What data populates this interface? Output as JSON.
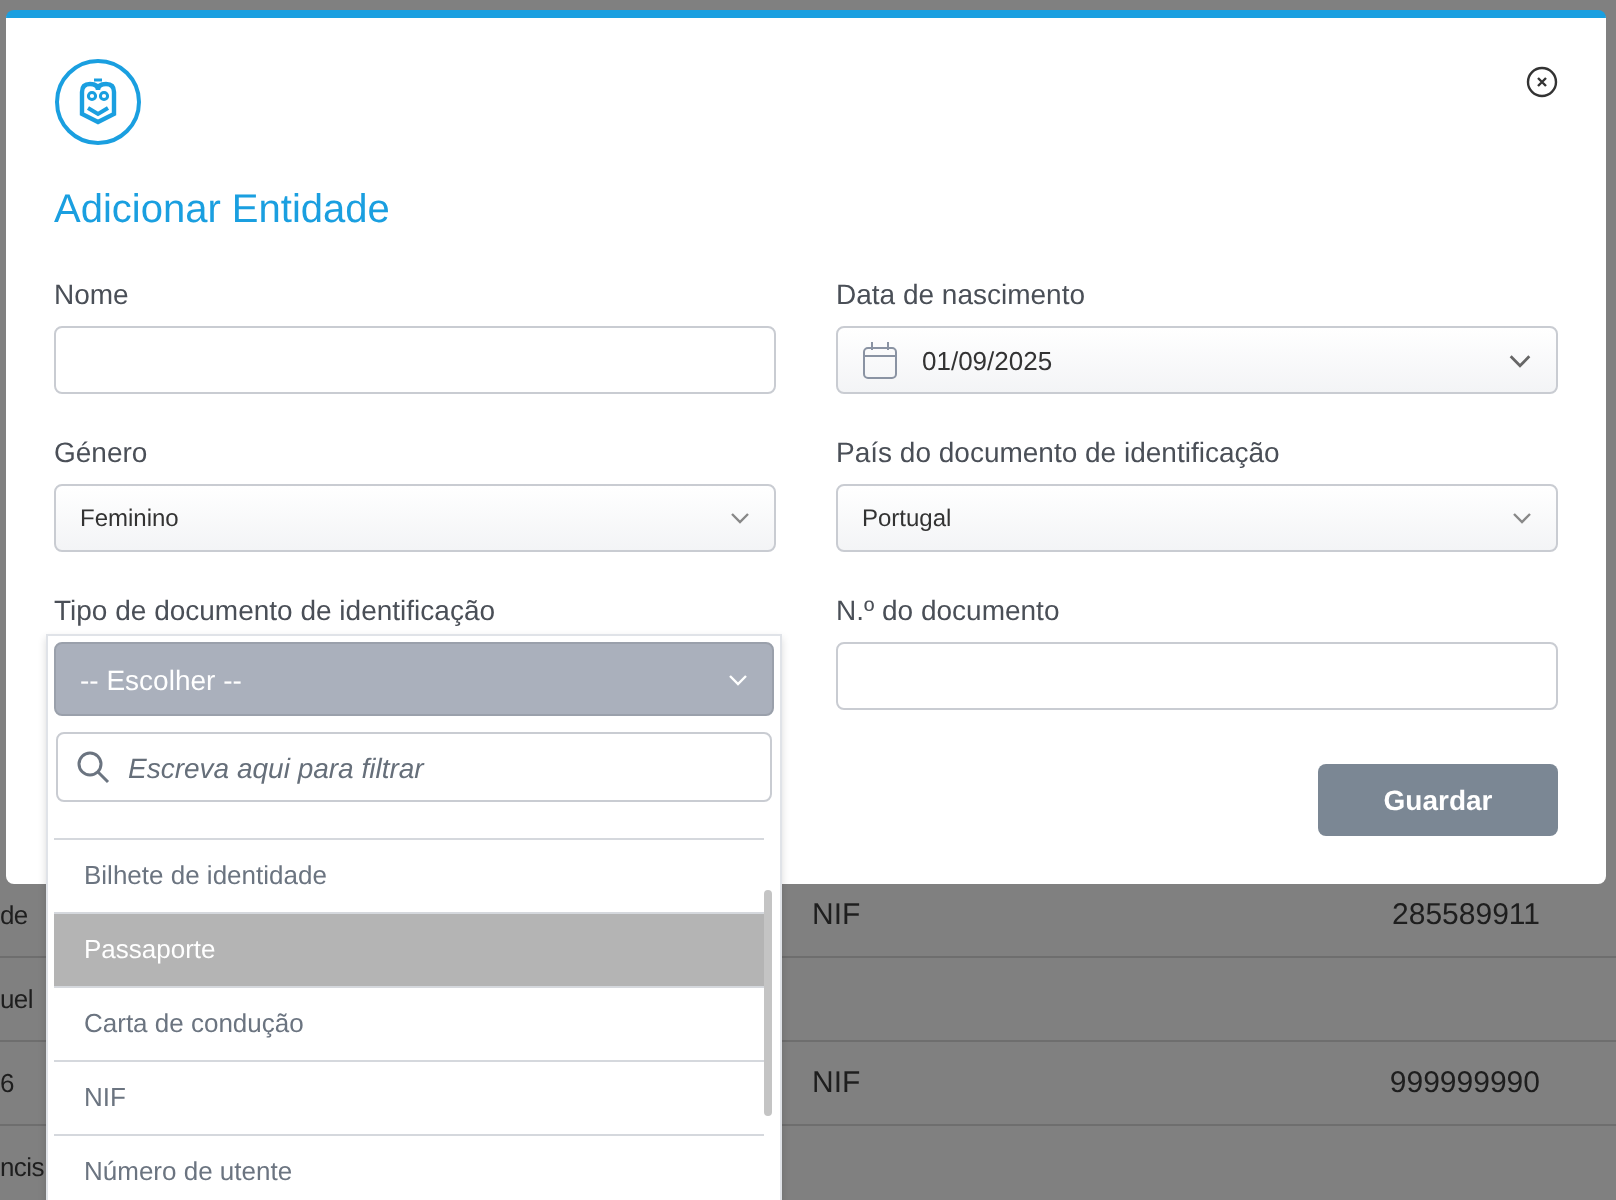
{
  "background_table": {
    "rows": [
      {
        "column_1": "de",
        "column_2": "NIF",
        "column_3": "285589911"
      },
      {
        "column_1": "uel"
      },
      {
        "column_1": "6",
        "column_2": "NIF",
        "column_3": "999999990"
      },
      {
        "column_1": "ncis"
      }
    ]
  },
  "dialog": {
    "title": "Adicionar Entidade",
    "fields": [
      {
        "kind": "text",
        "label": "Nome"
      },
      {
        "kind": "date",
        "label": "Data de nascimento",
        "value": "01/09/2025"
      },
      {
        "kind": "select",
        "label": "Género",
        "value": "Feminino"
      },
      {
        "kind": "select",
        "label": "País do documento de identificação",
        "value": "Portugal"
      },
      {
        "kind": "dropdown",
        "label": "Tipo de documento de identificação",
        "placeholder": "-- Escolher --",
        "expanded": true,
        "filter_placeholder": "Escreva aqui para filtrar",
        "options": [
          {
            "label": "Bilhete de identidade",
            "selected": false
          },
          {
            "label": "Passaporte",
            "selected": true
          },
          {
            "label": "Carta de condução",
            "selected": false
          },
          {
            "label": "NIF",
            "selected": false
          },
          {
            "label": "Número de utente",
            "selected": false
          }
        ]
      },
      {
        "kind": "text",
        "label": "N.º do documento"
      }
    ],
    "save_button": "Guardar"
  }
}
